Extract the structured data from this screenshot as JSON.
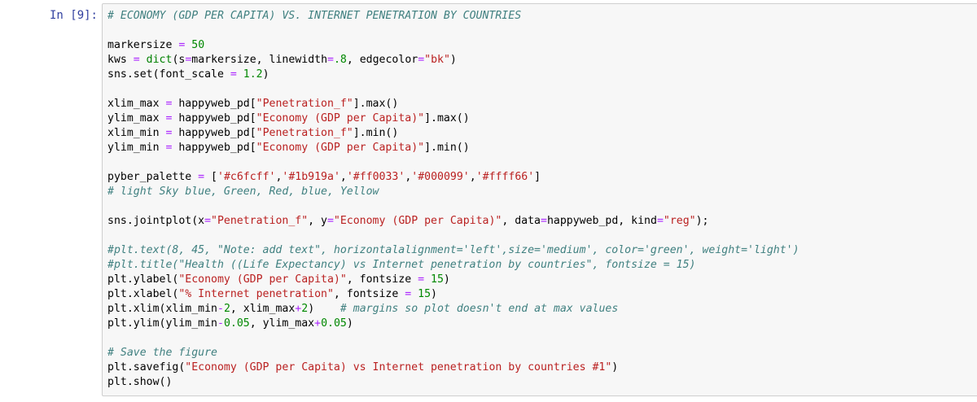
{
  "prompt": "In [9]:",
  "code_lines": [
    "# ECONOMY (GDP PER CAPITA) VS. INTERNET PENETRATION BY COUNTRIES",
    "",
    "markersize = 50",
    "kws = dict(s=markersize, linewidth=.8, edgecolor=\"bk\")",
    "sns.set(font_scale = 1.2)",
    "",
    "xlim_max = happyweb_pd[\"Penetration_f\"].max()",
    "ylim_max = happyweb_pd[\"Economy (GDP per Capita)\"].max()",
    "xlim_min = happyweb_pd[\"Penetration_f\"].min()",
    "ylim_min = happyweb_pd[\"Economy (GDP per Capita)\"].min()",
    "",
    "pyber_palette = ['#c6fcff','#1b919a','#ff0033','#000099','#ffff66']",
    "# light Sky blue, Green, Red, blue, Yellow",
    "",
    "sns.jointplot(x=\"Penetration_f\", y=\"Economy (GDP per Capita)\", data=happyweb_pd, kind=\"reg\");",
    "",
    "#plt.text(8, 45, \"Note: add text\", horizontalalignment='left',size='medium', color='green', weight='light')",
    "#plt.title(\"Health ((Life Expectancy) vs Internet penetration by countries\", fontsize = 15)",
    "plt.ylabel(\"Economy (GDP per Capita)\", fontsize = 15)",
    "plt.xlabel(\"% Internet penetration\", fontsize = 15)",
    "plt.xlim(xlim_min-2, xlim_max+2)    # margins so plot doesn't end at max values",
    "plt.ylim(ylim_min-0.05, ylim_max+0.05)",
    "",
    "# Save the figure",
    "plt.savefig(\"Economy (GDP per Capita) vs Internet penetration by countries #1\")",
    "plt.show()"
  ]
}
